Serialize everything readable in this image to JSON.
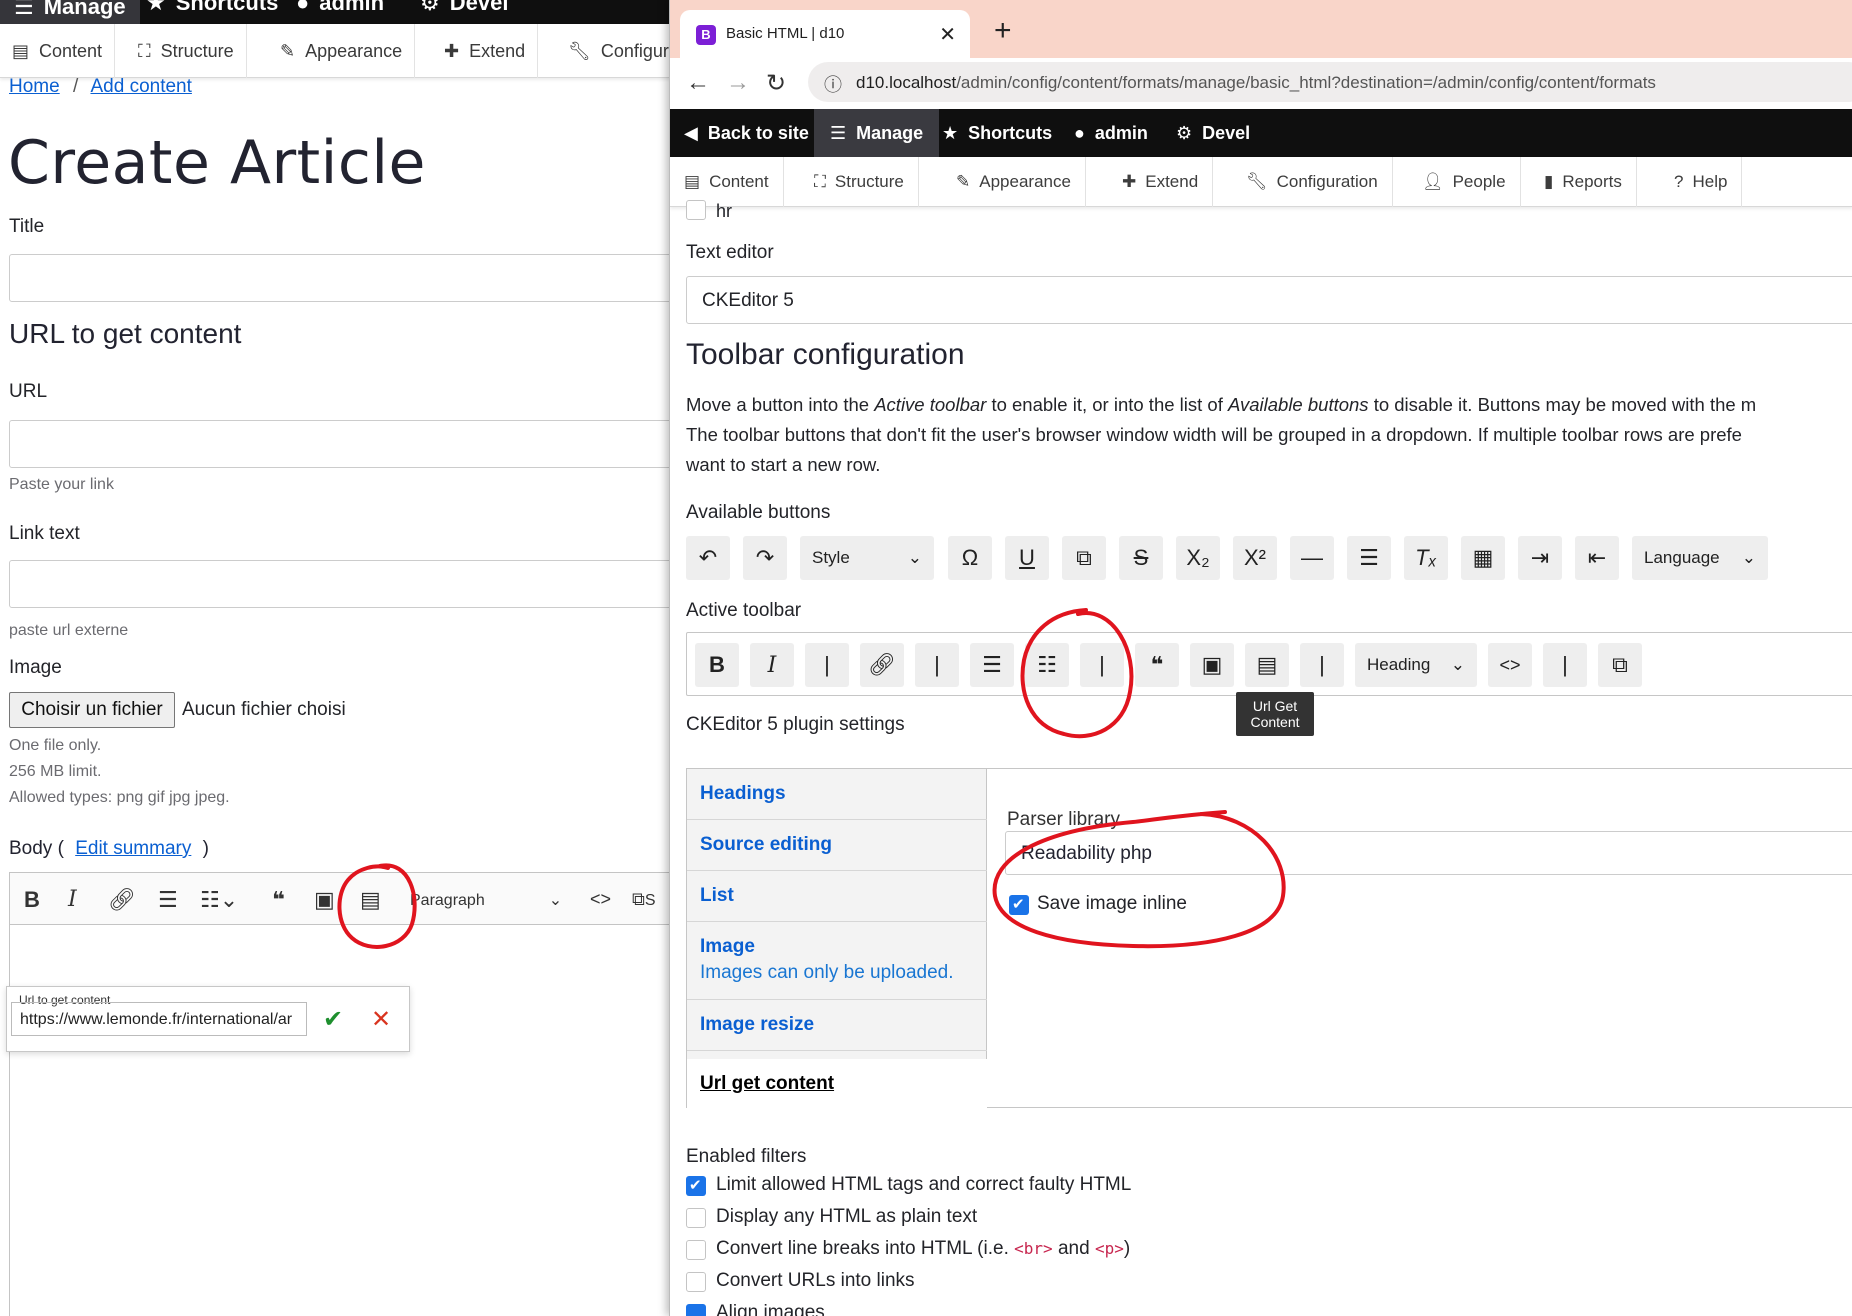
{
  "left": {
    "topbar": {
      "manage": "Manage",
      "shortcuts": "Shortcuts",
      "admin": "admin",
      "devel": "Devel"
    },
    "adminbar": {
      "content": "Content",
      "structure": "Structure",
      "appearance": "Appearance",
      "extend": "Extend",
      "configuration": "Configur"
    },
    "breadcrumb": {
      "home": "Home",
      "sep": "/",
      "add_content": "Add content"
    },
    "page_title": "Create Article",
    "title_label": "Title",
    "url_section_heading": "URL to get content",
    "url_label": "URL",
    "url_desc": "Paste your link",
    "link_text_label": "Link text",
    "link_text_desc": "paste url externe",
    "image_label": "Image",
    "file_button": "Choisir un fichier",
    "file_none": "Aucun fichier choisi",
    "image_desc": [
      "One file only.",
      "256 MB limit.",
      "Allowed types: png gif jpg jpeg."
    ],
    "body_label": "Body (",
    "body_edit_summary": "Edit summary",
    "body_label_end": ")",
    "editor": {
      "paragraph": "Paragraph",
      "trailing": "S"
    },
    "popup": {
      "label": "Url to get content",
      "value": "https://www.lemonde.fr/international/ar"
    }
  },
  "browser": {
    "tab_title": "Basic HTML | d10",
    "favicon_letter": "B",
    "url_host": "d10.localhost",
    "url_path": "/admin/config/content/formats/manage/basic_html?destination=/admin/config/content/formats"
  },
  "right": {
    "topbar": {
      "back": "Back to site",
      "manage": "Manage",
      "shortcuts": "Shortcuts",
      "admin": "admin",
      "devel": "Devel"
    },
    "adminbar": {
      "content": "Content",
      "structure": "Structure",
      "appearance": "Appearance",
      "extend": "Extend",
      "configuration": "Configuration",
      "people": "People",
      "reports": "Reports",
      "help": "Help"
    },
    "hr_fragment": "hr",
    "text_editor_label": "Text editor",
    "text_editor_value": "CKEditor 5",
    "toolbar_heading": "Toolbar configuration",
    "toolbar_desc_line1_a": "Move a button into the ",
    "toolbar_desc_line1_b": "Active toolbar",
    "toolbar_desc_line1_c": " to enable it, or into the list of ",
    "toolbar_desc_line1_d": "Available buttons",
    "toolbar_desc_line1_e": " to disable it. Buttons may be moved with the m",
    "toolbar_desc_line2": "The toolbar buttons that don't fit the user's browser window width will be grouped in a dropdown. If multiple toolbar rows are prefe",
    "toolbar_desc_line3": "want to start a new row.",
    "available_label": "Available buttons",
    "available_style": "Style",
    "available_language": "Language",
    "active_label": "Active toolbar",
    "active_heading": "Heading",
    "tooltip_line1": "Url Get",
    "tooltip_line2": "Content",
    "plugin_settings_label": "CKEditor 5 plugin settings",
    "vtabs": {
      "headings": "Headings",
      "source_editing": "Source editing",
      "list": "List",
      "image": "Image",
      "image_sub": "Images can only be uploaded.",
      "image_resize": "Image resize",
      "url_get_content": "Url get content"
    },
    "parser_label": "Parser library",
    "parser_value": "Readability php",
    "save_inline_label": "Save image inline",
    "save_inline_checked": true,
    "enabled_filters_label": "Enabled filters",
    "filters": [
      {
        "label": "Limit allowed HTML tags and correct faulty HTML",
        "checked": true
      },
      {
        "label": "Display any HTML as plain text",
        "checked": false
      },
      {
        "label_a": "Convert line breaks into HTML (i.e. ",
        "code1": "<br>",
        "label_b": " and ",
        "code2": "<p>",
        "label_c": ")",
        "checked": false
      },
      {
        "label": "Convert URLs into links",
        "checked": false
      },
      {
        "label": "Align images",
        "checked": true
      }
    ]
  },
  "colors": {
    "link_blue": "#0a5fd1",
    "toolbar_black": "#0f0f0f",
    "tab_strip": "#f9d5c9",
    "annotation_red": "#e0141e",
    "checkbox_blue": "#1a73e8"
  }
}
